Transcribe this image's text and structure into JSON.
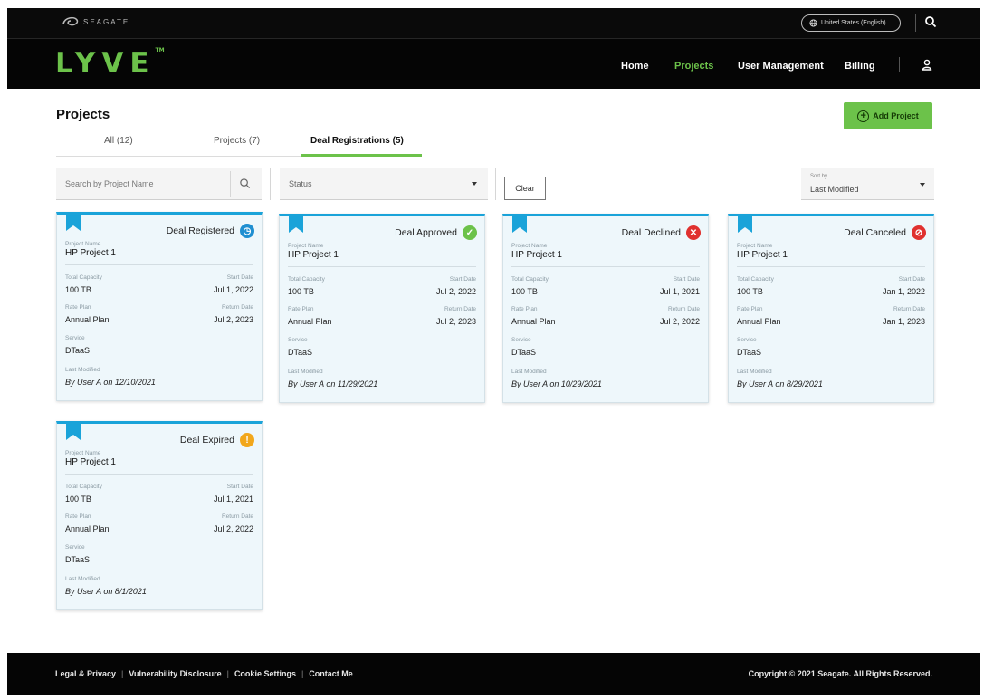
{
  "topbar": {
    "brand": "SEAGATE",
    "region": "United States (English)"
  },
  "brandbar": {
    "logo": "LYVE",
    "logo_tm": "TM",
    "nav": [
      "Home",
      "Projects",
      "User Management",
      "Billing"
    ],
    "active_nav": "Projects"
  },
  "page": {
    "title": "Projects",
    "add_button": "Add Project",
    "tabs": [
      "All (12)",
      "Projects (7)",
      "Deal Registrations (5)"
    ],
    "active_tab": "Deal Registrations (5)"
  },
  "filters": {
    "search_placeholder": "Search by Project Name",
    "status_value": "Status",
    "clear_label": "Clear",
    "sort_label": "Sort by",
    "sort_value": "Last Modified"
  },
  "labels": {
    "project_name": "Project Name",
    "total_capacity": "Total Capacity",
    "start_date": "Start Date",
    "rate_plan": "Rate Plan",
    "return_date": "Return Date",
    "service": "Service",
    "last_modified": "Last Modified"
  },
  "cards": [
    {
      "status": "Deal Registered",
      "status_color": "#1f8fd1",
      "status_icon": "clock-icon",
      "name": "HP Project 1",
      "capacity": "100 TB",
      "start": "Jul 1, 2022",
      "plan": "Annual Plan",
      "return": "Jul 2, 2023",
      "service": "DTaaS",
      "modified": "By User A on 12/10/2021"
    },
    {
      "status": "Deal Approved",
      "status_color": "#6cc24a",
      "status_icon": "check-icon",
      "name": "HP Project 1",
      "capacity": "100 TB",
      "start": "Jul 2, 2022",
      "plan": "Annual Plan",
      "return": "Jul 2, 2023",
      "service": "DTaaS",
      "modified": "By User A on 11/29/2021"
    },
    {
      "status": "Deal Declined",
      "status_color": "#e0312f",
      "status_icon": "x-icon",
      "name": "HP Project 1",
      "capacity": "100 TB",
      "start": "Jul 1, 2021",
      "plan": "Annual Plan",
      "return": "Jul 2, 2022",
      "service": "DTaaS",
      "modified": "By User A on 10/29/2021"
    },
    {
      "status": "Deal Canceled",
      "status_color": "#e0312f",
      "status_icon": "prohibited-icon",
      "name": "HP Project 1",
      "capacity": "100 TB",
      "start": "Jan 1, 2022",
      "plan": "Annual Plan",
      "return": "Jan 1, 2023",
      "service": "DTaaS",
      "modified": "By User A on 8/29/2021"
    },
    {
      "status": "Deal Expired",
      "status_color": "#f2a71b",
      "status_icon": "exclamation-icon",
      "name": "HP Project 1",
      "capacity": "100 TB",
      "start": "Jul 1, 2021",
      "plan": "Annual Plan",
      "return": "Jul 2, 2022",
      "service": "DTaaS",
      "modified": "By User A on 8/1/2021"
    }
  ],
  "footer": {
    "links": [
      "Legal & Privacy",
      "Vulnerability Disclosure",
      "Cookie Settings",
      "Contact Me"
    ],
    "copyright": "Copyright © 2021 Seagate. All Rights Reserved."
  },
  "colors": {
    "accent": "#6cc24a",
    "card_top": "#1aa3d9",
    "card_bg": "#eef7fb"
  }
}
